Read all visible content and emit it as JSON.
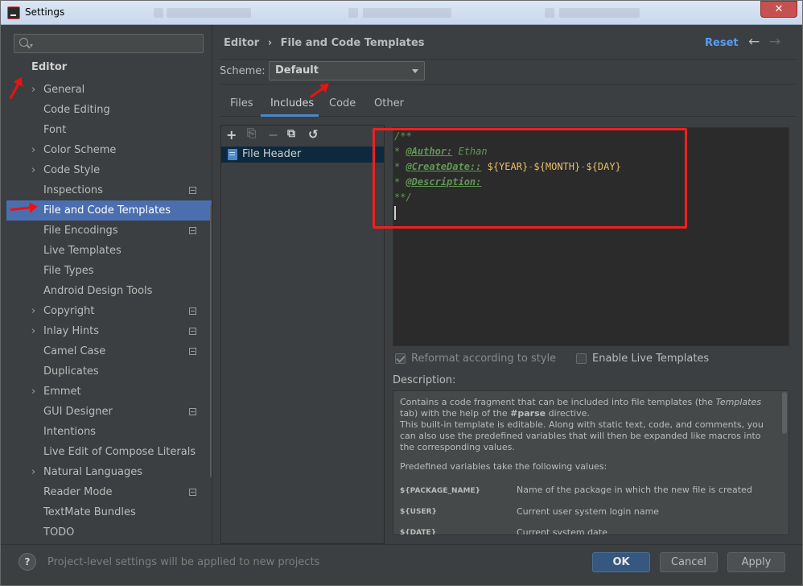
{
  "window": {
    "title": "Settings",
    "close_glyph": "✕"
  },
  "search": {
    "placeholder": ""
  },
  "sidebar": {
    "heading": "Editor",
    "items": [
      {
        "label": "General",
        "expandable": true,
        "project": false
      },
      {
        "label": "Code Editing",
        "expandable": false,
        "project": false
      },
      {
        "label": "Font",
        "expandable": false,
        "project": false
      },
      {
        "label": "Color Scheme",
        "expandable": true,
        "project": false
      },
      {
        "label": "Code Style",
        "expandable": true,
        "project": false
      },
      {
        "label": "Inspections",
        "expandable": false,
        "project": true
      },
      {
        "label": "File and Code Templates",
        "expandable": false,
        "project": false,
        "selected": true
      },
      {
        "label": "File Encodings",
        "expandable": false,
        "project": true
      },
      {
        "label": "Live Templates",
        "expandable": false,
        "project": false
      },
      {
        "label": "File Types",
        "expandable": false,
        "project": false
      },
      {
        "label": "Android Design Tools",
        "expandable": false,
        "project": false
      },
      {
        "label": "Copyright",
        "expandable": true,
        "project": true
      },
      {
        "label": "Inlay Hints",
        "expandable": true,
        "project": true
      },
      {
        "label": "Camel Case",
        "expandable": false,
        "project": true
      },
      {
        "label": "Duplicates",
        "expandable": false,
        "project": false
      },
      {
        "label": "Emmet",
        "expandable": true,
        "project": false
      },
      {
        "label": "GUI Designer",
        "expandable": false,
        "project": true
      },
      {
        "label": "Intentions",
        "expandable": false,
        "project": false
      },
      {
        "label": "Live Edit of Compose Literals",
        "expandable": false,
        "project": false
      },
      {
        "label": "Natural Languages",
        "expandable": true,
        "project": false
      },
      {
        "label": "Reader Mode",
        "expandable": false,
        "project": true
      },
      {
        "label": "TextMate Bundles",
        "expandable": false,
        "project": false
      },
      {
        "label": "TODO",
        "expandable": false,
        "project": false
      }
    ]
  },
  "header": {
    "crumb_parent": "Editor",
    "crumb_sep": "›",
    "crumb_current": "File and Code Templates",
    "reset_label": "Reset",
    "back_glyph": "←",
    "forward_glyph": "→"
  },
  "scheme": {
    "label": "Scheme:",
    "value": "Default"
  },
  "tabs": [
    {
      "label": "Files",
      "active": false
    },
    {
      "label": "Includes",
      "active": true
    },
    {
      "label": "Code",
      "active": false
    },
    {
      "label": "Other",
      "active": false
    }
  ],
  "toolbar": {
    "add": "+",
    "copy_disabled": "⎘",
    "remove": "−",
    "duplicate": "⧉",
    "revert": "↺"
  },
  "templates_list": [
    {
      "label": "File Header",
      "selected": true
    }
  ],
  "editor": {
    "line1": "/**",
    "line2_prefix": "* ",
    "line2_tag": "@Author:",
    "line2_value": " Ethan",
    "line3_prefix": "* ",
    "line3_tag": "@CreateDate::",
    "line3_sp": " ",
    "var_year": "${YEAR}",
    "dash": "-",
    "var_month": "${MONTH}",
    "var_day": "${DAY}",
    "line4_prefix": "* ",
    "line4_tag": "@Description:",
    "line5": "**/"
  },
  "options": {
    "reformat_label": "Reformat according to style",
    "reformat_checked": true,
    "live_templates_label": "Enable Live Templates",
    "live_templates_checked": false
  },
  "description": {
    "label": "Description:",
    "p1_a": "Contains a code fragment that can be included into file templates (the ",
    "p1_templates": "Templates",
    "p1_b": " tab) with the help of the ",
    "p1_parse": "#parse",
    "p1_c": " directive.",
    "p2": "This built-in template is editable. Along with static text, code, and comments, you can also use the predefined variables that will then be expanded like macros into the corresponding values.",
    "p3": "Predefined variables take the following values:",
    "variables": [
      {
        "name": "${PACKAGE_NAME}",
        "desc": "Name of the package in which the new file is created"
      },
      {
        "name": "${USER}",
        "desc": "Current user system login name"
      },
      {
        "name": "${DATE}",
        "desc": "Current system date"
      }
    ]
  },
  "footer": {
    "help_glyph": "?",
    "hint": "Project-level settings will be applied to new projects",
    "ok_label": "OK",
    "cancel_label": "Cancel",
    "apply_label": "Apply"
  },
  "colors": {
    "accent": "#4b6eaf",
    "link": "#589df6",
    "annotation": "#f02020"
  }
}
